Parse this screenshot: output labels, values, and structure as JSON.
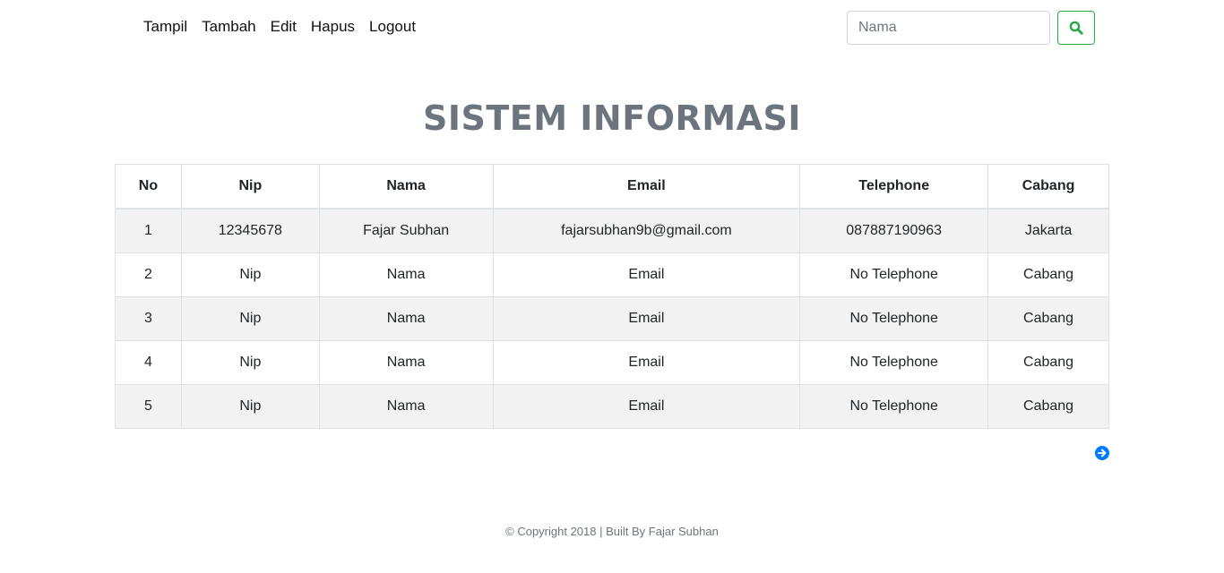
{
  "nav": {
    "links": [
      "Tampil",
      "Tambah",
      "Edit",
      "Hapus",
      "Logout"
    ]
  },
  "search": {
    "placeholder": "Nama",
    "value": "",
    "button_icon": "search-icon",
    "button_color": "#28a745"
  },
  "page_title": "SISTEM INFORMASI",
  "table": {
    "headers": [
      "No",
      "Nip",
      "Nama",
      "Email",
      "Telephone",
      "Cabang"
    ],
    "rows": [
      [
        "1",
        "12345678",
        "Fajar Subhan",
        "fajarsubhan9b@gmail.com",
        "087887190963",
        "Jakarta"
      ],
      [
        "2",
        "Nip",
        "Nama",
        "Email",
        "No Telephone",
        "Cabang"
      ],
      [
        "3",
        "Nip",
        "Nama",
        "Email",
        "No Telephone",
        "Cabang"
      ],
      [
        "4",
        "Nip",
        "Nama",
        "Email",
        "No Telephone",
        "Cabang"
      ],
      [
        "5",
        "Nip",
        "Nama",
        "Email",
        "No Telephone",
        "Cabang"
      ]
    ]
  },
  "pagination": {
    "next_icon": "arrow-right-circle-icon",
    "color": "#007bff"
  },
  "footer": {
    "text": "© Copyright 2018 | Built By Fajar Subhan"
  }
}
